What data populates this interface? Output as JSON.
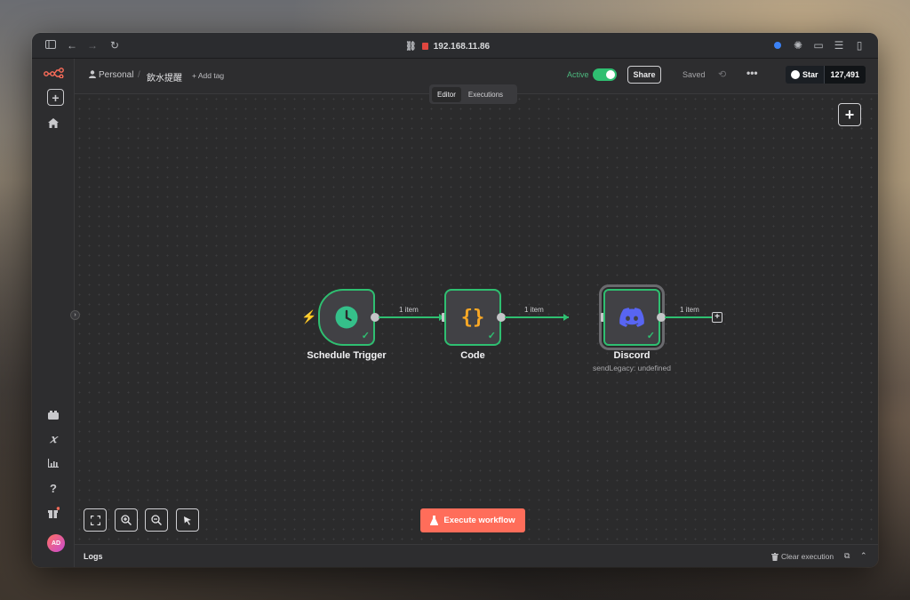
{
  "browser": {
    "url": "192.168.11.86",
    "icons": [
      "sidebar-toggle-icon",
      "back-arrow-icon",
      "forward-arrow-icon",
      "reload-icon",
      "link-icon",
      "lock-icon"
    ]
  },
  "sidebar": {
    "logo": "n8n-logo-icon",
    "add_icon": "+",
    "avatar_initials": "AD"
  },
  "topbar": {
    "breadcrumb_project": "Personal",
    "breadcrumb_separator": "/",
    "workflow_name": "飲水提醒",
    "add_tag": "+ Add tag",
    "active_label": "Active",
    "active": true,
    "share_label": "Share",
    "saved_label": "Saved",
    "more_label": "•••",
    "github_star_label": "Star",
    "github_star_count": "127,491"
  },
  "tabs": [
    {
      "label": "Editor",
      "selected": true
    },
    {
      "label": "Executions",
      "selected": false
    }
  ],
  "workflow": {
    "nodes": [
      {
        "name": "Schedule Trigger",
        "icon": "clock-icon",
        "status": "success"
      },
      {
        "name": "Code",
        "icon": "code-braces-icon",
        "status": "success"
      },
      {
        "name": "Discord",
        "icon": "discord-icon",
        "status": "success",
        "subtitle": "sendLegacy: undefined"
      }
    ],
    "edges": [
      {
        "label": "1 item"
      },
      {
        "label": "1 item"
      },
      {
        "label": "1 item"
      }
    ],
    "trigger_marker": "⚡"
  },
  "canvas_controls": {
    "fit_view": "fit-view-icon",
    "zoom_in": "zoom-in-icon",
    "zoom_out": "zoom-out-icon",
    "tidy": "tidy-up-icon"
  },
  "execute_button": "Execute workflow",
  "logs": {
    "title": "Logs",
    "clear_execution": "Clear execution"
  },
  "colors": {
    "accent": "#ff6d5a",
    "success": "#2fbf71",
    "discord": "#5865f2",
    "code": "#f9a825"
  }
}
